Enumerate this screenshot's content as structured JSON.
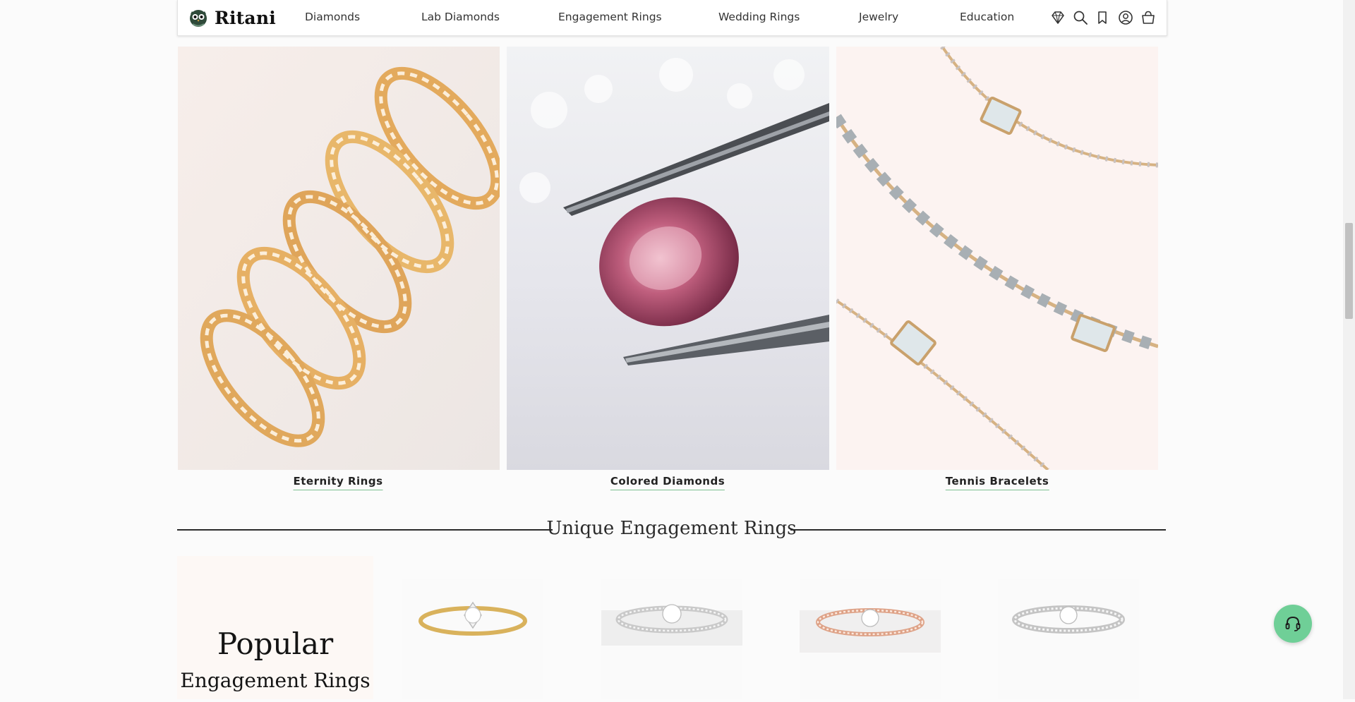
{
  "brand": {
    "name": "Ritani"
  },
  "nav": {
    "items": [
      {
        "label": "Diamonds"
      },
      {
        "label": "Lab Diamonds"
      },
      {
        "label": "Engagement Rings"
      },
      {
        "label": "Wedding Rings"
      },
      {
        "label": "Jewelry"
      },
      {
        "label": "Education"
      }
    ]
  },
  "header_icons": [
    "diamond-icon",
    "search-icon",
    "bookmark-icon",
    "account-icon",
    "cart-icon"
  ],
  "categories": [
    {
      "label": "Eternity Rings"
    },
    {
      "label": "Colored Diamonds"
    },
    {
      "label": "Tennis Bracelets"
    }
  ],
  "section": {
    "title": "Unique Engagement Rings"
  },
  "popular": {
    "title": "Popular",
    "subtitle": "Engagement Rings"
  },
  "rings": [
    {
      "metal": "yellow gold",
      "color": "#d9b25c"
    },
    {
      "metal": "white gold pave",
      "color": "#c9c9c9"
    },
    {
      "metal": "rose gold pave",
      "color": "#dea287"
    },
    {
      "metal": "platinum pave",
      "color": "#c4c4c4"
    }
  ],
  "colors": {
    "accent": "#6fcf97",
    "caption_underline": "#7dbf90",
    "rule": "#2b2b2b"
  },
  "chat": {
    "icon": "headset-icon"
  }
}
